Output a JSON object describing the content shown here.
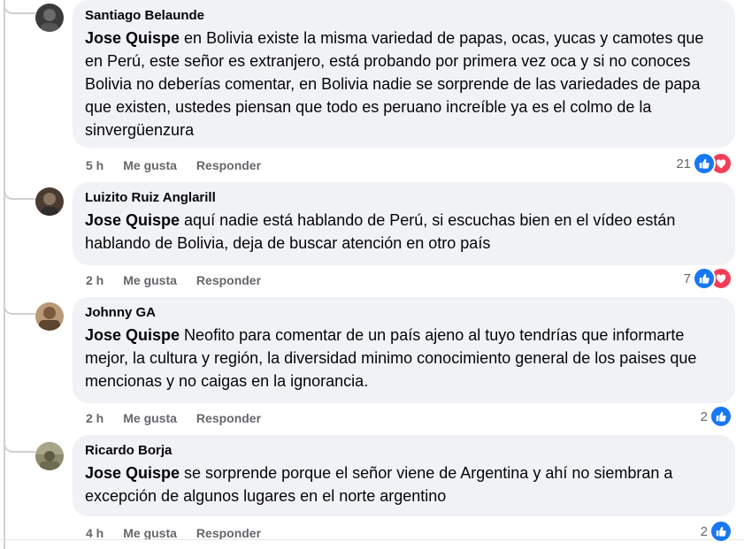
{
  "comments": [
    {
      "author": "Santiago Belaunde",
      "mention": "Jose Quispe",
      "text": " en Bolivia existe la misma variedad de papas, ocas, yucas y camotes que en Perú, este señor es extranjero, está probando por primera vez oca y si no conoces Bolivia no deberías comentar, en Bolivia nadie se sorprende de las variedades de papa que existen, ustedes piensan que todo es peruano increíble ya es el colmo de la sinvergüenzura",
      "time": "5 h",
      "like_label": "Me gusta",
      "reply_label": "Responder",
      "reactions_count": "21",
      "reactions": [
        "like-icon",
        "love-icon"
      ]
    },
    {
      "author": "Luizito Ruiz Anglarill",
      "mention": "Jose Quispe",
      "text": " aquí nadie está hablando de Perú, si escuchas bien en el vídeo están hablando de Bolivia, deja de buscar atención en otro país",
      "time": "2 h",
      "like_label": "Me gusta",
      "reply_label": "Responder",
      "reactions_count": "7",
      "reactions": [
        "like-icon",
        "love-icon"
      ]
    },
    {
      "author": "Johnny GA",
      "mention": "Jose Quispe",
      "text": " Neofito para comentar de un país ajeno al tuyo tendrías que informarte mejor, la cultura y región, la diversidad minimo conocimiento general de los paises que mencionas y no caigas en la ignorancia.",
      "time": "2 h",
      "like_label": "Me gusta",
      "reply_label": "Responder",
      "reactions_count": "2",
      "reactions": [
        "like-icon"
      ]
    },
    {
      "author": "Ricardo Borja",
      "mention": "Jose Quispe",
      "text": " se sorprende porque el señor viene de Argentina y ahí no siembran a excepción de algunos lugares en el norte argentino",
      "time": "4 h",
      "like_label": "Me gusta",
      "reply_label": "Responder",
      "reactions_count": "2",
      "reactions": [
        "like-icon"
      ]
    }
  ],
  "colors": {
    "bubble": "#f0f2f5",
    "like": "#1877f2",
    "love": "#f33e58",
    "secondary_text": "#65676b"
  }
}
